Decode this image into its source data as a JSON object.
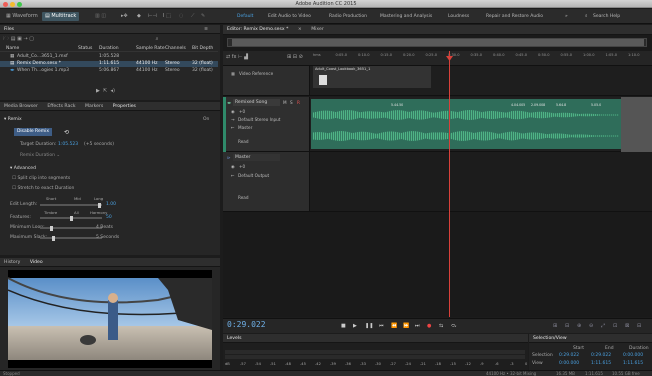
{
  "window": {
    "title": "Adobe Audition CC 2015"
  },
  "toolbar": {
    "waveform": "Waveform",
    "multitrack": "Multitrack",
    "workspaces": [
      "Default",
      "Edit Audio to Video",
      "Radio Production",
      "Mastering and Analysis",
      "Loudness",
      "Repair and Restore Audio"
    ],
    "more": "»",
    "search_placeholder": "Search Help"
  },
  "files": {
    "tab": "Files",
    "menu": "≡",
    "columns": {
      "name": "Name",
      "status": "Status",
      "duration": "Duration",
      "sample_rate": "Sample Rate",
      "channels": "Channels",
      "bit_depth": "Bit Depth"
    },
    "rows": [
      {
        "name": "Adult_Co...3651_1.mxf",
        "duration": "1:05.528",
        "sample_rate": "",
        "channels": "",
        "bit_depth": ""
      },
      {
        "name": "Remix Demo.sesx *",
        "duration": "1:11.615",
        "sample_rate": "44100 Hz",
        "channels": "Stereo",
        "bit_depth": "32 (float)"
      },
      {
        "name": "When Th...ogies 1.mp3",
        "duration": "5:06.867",
        "sample_rate": "44100 Hz",
        "channels": "Stereo",
        "bit_depth": "32 (float)"
      }
    ]
  },
  "properties": {
    "tabs": [
      "Media Browser",
      "Effects Rack",
      "Markers",
      "Properties"
    ],
    "active_tab": "Properties",
    "section": "Remix",
    "on_label": "On",
    "disable_remix": "Disable Remix",
    "target_duration_label": "Target Duration:",
    "target_duration_value": "1:05.523",
    "target_duration_note": "(+5 seconds)",
    "remix_duration": "Remix Duration",
    "advanced": "Advanced",
    "split_clip": "Split clip into segments",
    "stretch": "Stretch to exact Duration",
    "edit_length_label": "Edit Length:",
    "edit_length_scale": [
      "Short",
      "Mid",
      "Long"
    ],
    "edit_length_value": "1.00",
    "features_label": "Features:",
    "features_scale": [
      "Timbre",
      "All",
      "Harmony"
    ],
    "features_value": "50",
    "minimum_loop_label": "Minimum Loop:",
    "minimum_loop_value": "4 Beats",
    "maximum_slack_label": "Maximum Slack:",
    "maximum_slack_value": "5 Seconds"
  },
  "video_panel": {
    "tabs": [
      "History",
      "Video"
    ],
    "active_tab": "Video"
  },
  "editor": {
    "tab": "Editor: Remix Demo.sesx *",
    "mixer_tab": "Mixer",
    "ruler": [
      "hms",
      "0:05.0",
      "0:10.0",
      "0:15.0",
      "0:20.0",
      "0:25.0",
      "0:30.0",
      "0:35.0",
      "0:40.0",
      "0:45.0",
      "0:50.0",
      "0:55.0",
      "1:00.0",
      "1:05.0",
      "1:10.0"
    ],
    "video_track": {
      "name": "Video Reference",
      "clip": "Adult_Coast_Lookbook_3651_1"
    },
    "tracks": [
      {
        "name": "Remixed Song",
        "flags": [
          "M",
          "S",
          "R"
        ],
        "volume": "+0",
        "input": "Default Stereo Input",
        "output": "Master",
        "mode": "Read"
      },
      {
        "name": "Master",
        "volume": "+0",
        "output": "Default Output",
        "mode": "Read"
      }
    ],
    "clip_markers": [
      "5.44.50",
      "4.04.005",
      "2.09.008",
      "5.64.8",
      "5.05.0"
    ]
  },
  "transport": {
    "timecode": "0:29.022"
  },
  "levels": {
    "title": "Levels",
    "scale": [
      "dB",
      "-57",
      "-54",
      "-51",
      "-48",
      "-45",
      "-42",
      "-39",
      "-36",
      "-33",
      "-30",
      "-27",
      "-24",
      "-21",
      "-18",
      "-15",
      "-12",
      "-9",
      "-6",
      "-3",
      "0"
    ]
  },
  "selection_view": {
    "title": "Selection/View",
    "headers": [
      "Start",
      "End",
      "Duration"
    ],
    "selection": {
      "label": "Selection",
      "start": "0:29.022",
      "end": "0:29.022",
      "duration": "0:00.000"
    },
    "view": {
      "label": "View",
      "start": "0:00.000",
      "end": "1:11.615",
      "duration": "1:11.615"
    }
  },
  "status": {
    "left": "Stopped",
    "right": [
      "44100 Hz • 32-bit Mixing",
      "16.35 MB",
      "1:11.615",
      "10.55 GB free"
    ]
  },
  "colors": {
    "accent": "#4aa0e0",
    "waveform": "#3b9a6a",
    "playhead": "#d9413a",
    "track_bg": "#2f6d5a"
  }
}
